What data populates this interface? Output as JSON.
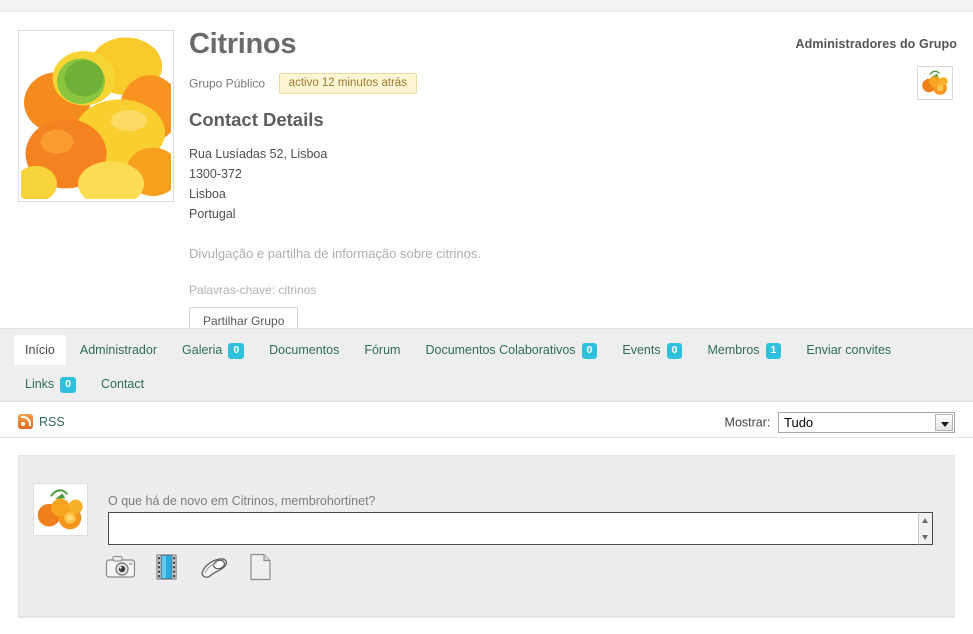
{
  "header": {
    "group_title": "Citrinos",
    "group_type": "Grupo Público",
    "active_badge": "activo 12 minutos atrás",
    "contact_heading": "Contact Details",
    "address_lines": [
      "Rua Lusíadas 52, Lisboa",
      "1300-372",
      "Lisboa",
      "Portugal"
    ],
    "description": "Divulgação e partilha de informação sobre citrinos.",
    "keywords": "Palavras-chave: citrinos",
    "share_button": "Partilhar Grupo",
    "admins_label": "Administradores do Grupo",
    "group_photo_alt": "citrus-fruit-photo",
    "admin_avatar_alt": "admin-oranges-avatar"
  },
  "tabs": [
    {
      "label": "Início",
      "count": null,
      "active": true
    },
    {
      "label": "Administrador",
      "count": null,
      "active": false
    },
    {
      "label": "Galeria",
      "count": "0",
      "active": false
    },
    {
      "label": "Documentos",
      "count": null,
      "active": false
    },
    {
      "label": "Fórum",
      "count": null,
      "active": false
    },
    {
      "label": "Documentos Colaborativos",
      "count": "0",
      "active": false
    },
    {
      "label": "Events",
      "count": "0",
      "active": false
    },
    {
      "label": "Membros",
      "count": "1",
      "active": false
    },
    {
      "label": "Enviar convites",
      "count": null,
      "active": false
    },
    {
      "label": "Links",
      "count": "0",
      "active": false
    },
    {
      "label": "Contact",
      "count": null,
      "active": false
    }
  ],
  "subbar": {
    "rss_label": "RSS",
    "show_label": "Mostrar:",
    "show_value": "Tudo",
    "show_options": [
      "Tudo"
    ]
  },
  "composer": {
    "prompt": "O que há de novo em Citrinos, membrohortinet?",
    "textarea_value": "",
    "textarea_placeholder": "",
    "avatar_alt": "user-oranges-avatar",
    "attachments": [
      {
        "name": "photo-icon",
        "title": "Foto"
      },
      {
        "name": "video-icon",
        "title": "Vídeo"
      },
      {
        "name": "audio-icon",
        "title": "Áudio"
      },
      {
        "name": "file-icon",
        "title": "Ficheiro"
      }
    ]
  },
  "colors": {
    "accent_badge": "#2ec0dd",
    "link_green": "#2f6b5b",
    "active_badge_bg": "#fdf5d3",
    "active_badge_border": "#e8dba4",
    "panel_bg": "#ededed",
    "tabbar_bg": "#eeeeee"
  }
}
